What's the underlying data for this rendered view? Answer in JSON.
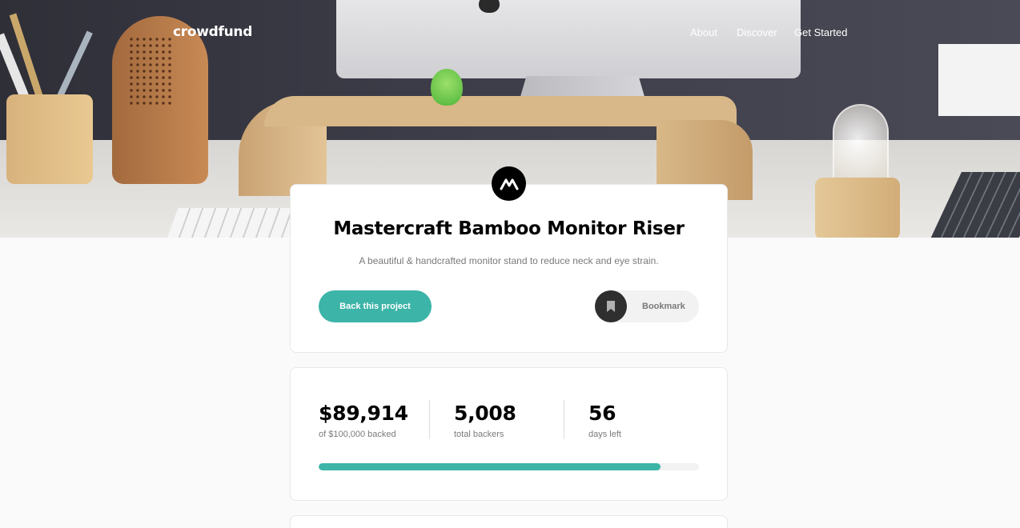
{
  "nav": {
    "logo": "crowdfund",
    "links": [
      "About",
      "Discover",
      "Get Started"
    ]
  },
  "project": {
    "logo_icon": "mastercraft-logo-icon",
    "title": "Mastercraft Bamboo Monitor Riser",
    "description": "A beautiful & handcrafted monitor stand to reduce neck and eye strain.",
    "back_button": "Back this project",
    "bookmark_label": "Bookmark",
    "bookmark_icon": "bookmark-icon"
  },
  "stats": {
    "backed_amount": "$89,914",
    "backed_label": "of $100,000 backed",
    "backers": "5,008",
    "backers_label": "total backers",
    "days": "56",
    "days_label": "days left",
    "progress_fraction": 0.899
  },
  "colors": {
    "accent": "#3cb4a8",
    "dark": "#2f2f2f",
    "muted": "#7a7a7a"
  }
}
